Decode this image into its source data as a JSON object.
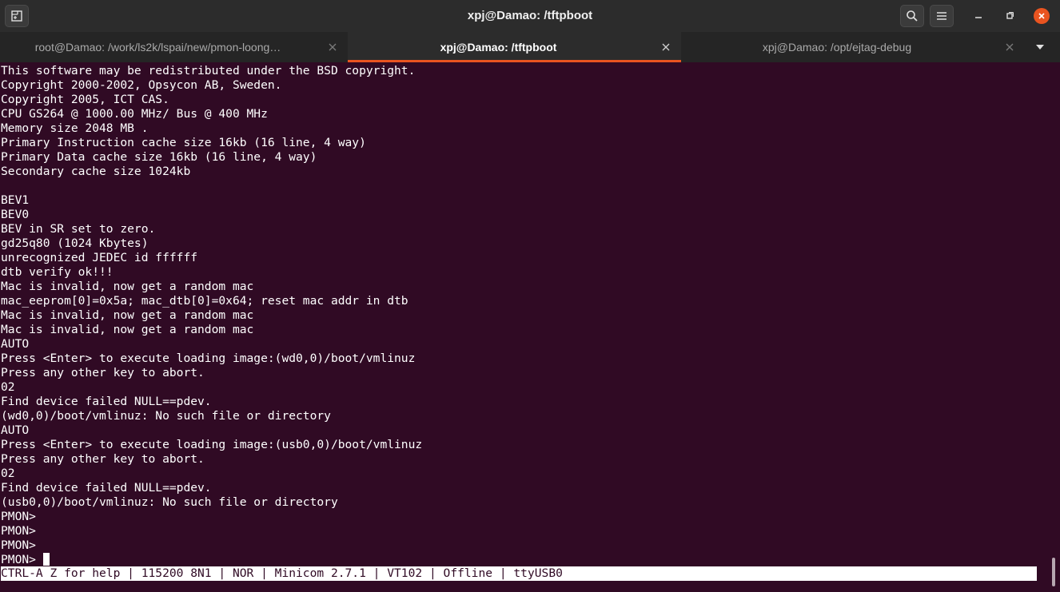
{
  "window": {
    "title": "xpj@Damao: /tftpboot"
  },
  "icons": {
    "new_tab": "new-tab-icon",
    "search": "search-icon",
    "menu": "hamburger-menu-icon",
    "minimize": "minimize-icon",
    "maximize": "maximize-icon",
    "close": "close-icon",
    "tab_list": "chevron-down-icon"
  },
  "colors": {
    "terminal_bg": "#300a24",
    "accent": "#e95420",
    "titlebar_bg": "#2c2c2c"
  },
  "tabs": [
    {
      "label": "root@Damao: /work/ls2k/lspai/new/pmon-loong…",
      "active": false
    },
    {
      "label": "xpj@Damao: /tftpboot",
      "active": true
    },
    {
      "label": "xpj@Damao: /opt/ejtag-debug",
      "active": false
    }
  ],
  "terminal": {
    "lines": [
      "This software may be redistributed under the BSD copyright.",
      "Copyright 2000-2002, Opsycon AB, Sweden.",
      "Copyright 2005, ICT CAS.",
      "CPU GS264 @ 1000.00 MHz/ Bus @ 400 MHz",
      "Memory size 2048 MB .",
      "Primary Instruction cache size 16kb (16 line, 4 way)",
      "Primary Data cache size 16kb (16 line, 4 way)",
      "Secondary cache size 1024kb",
      "",
      "BEV1",
      "BEV0",
      "BEV in SR set to zero.",
      "gd25q80 (1024 Kbytes)",
      "unrecognized JEDEC id ffffff",
      "dtb verify ok!!!",
      "Mac is invalid, now get a random mac",
      "mac_eeprom[0]=0x5a; mac_dtb[0]=0x64; reset mac addr in dtb",
      "Mac is invalid, now get a random mac",
      "Mac is invalid, now get a random mac",
      "AUTO",
      "Press <Enter> to execute loading image:(wd0,0)/boot/vmlinuz",
      "Press any other key to abort.",
      "02",
      "Find device failed NULL==pdev.",
      "(wd0,0)/boot/vmlinuz: No such file or directory",
      "AUTO",
      "Press <Enter> to execute loading image:(usb0,0)/boot/vmlinuz",
      "Press any other key to abort.",
      "02",
      "Find device failed NULL==pdev.",
      "(usb0,0)/boot/vmlinuz: No such file or directory",
      "PMON>",
      "PMON>",
      "PMON>"
    ],
    "prompt": "PMON> ",
    "status_line": "CTRL-A Z for help | 115200 8N1 | NOR | Minicom 2.7.1 | VT102 | Offline | ttyUSB0"
  }
}
